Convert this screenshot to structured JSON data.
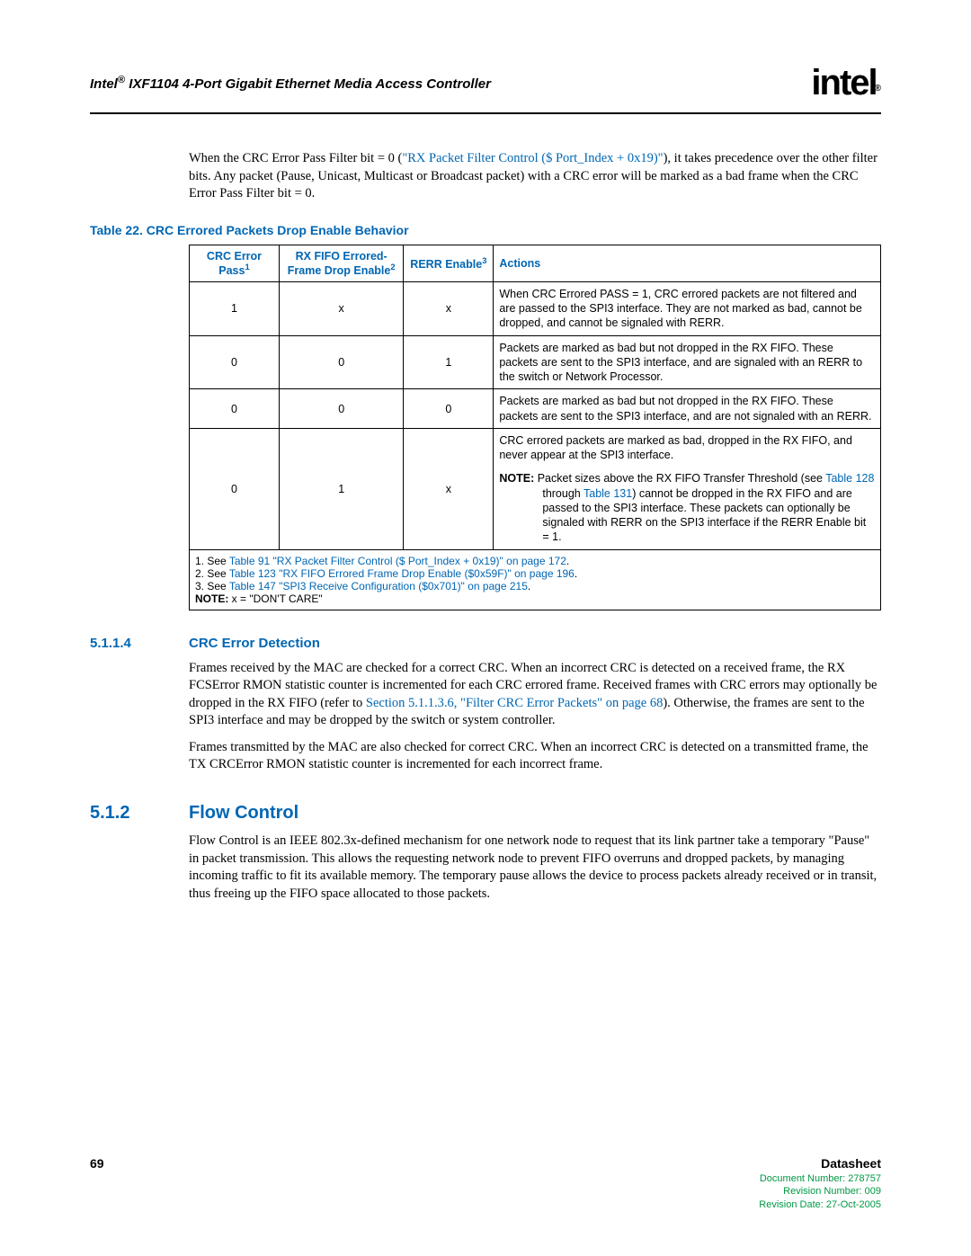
{
  "header": {
    "doc_title_prefix": "Intel",
    "doc_title_reg": "®",
    "doc_title_rest": " IXF1104 4-Port Gigabit Ethernet Media Access Controller",
    "logo_text": "intel"
  },
  "intro_para_pre": "When the CRC Error Pass Filter bit = 0 (",
  "intro_para_link": "\"RX Packet Filter Control ($ Port_Index + 0x19)\"",
  "intro_para_post": "), it takes precedence over the other filter bits. Any packet (Pause, Unicast, Multicast or Broadcast packet) with a CRC error will be marked as a bad frame when the CRC Error Pass Filter bit = 0.",
  "table_caption": "Table 22. CRC Errored Packets Drop Enable Behavior",
  "table_headers": {
    "h1": "CRC Error Pass",
    "h1_sup": "1",
    "h2": "RX FIFO Errored-Frame Drop Enable",
    "h2_sup": "2",
    "h3": "RERR Enable",
    "h3_sup": "3",
    "h4": "Actions"
  },
  "table_rows": [
    {
      "c1": "1",
      "c2": "x",
      "c3": "x",
      "actions": "When CRC Errored PASS = 1, CRC errored packets are not filtered and are passed to the SPI3 interface. They are not marked as bad, cannot be dropped, and cannot be signaled with RERR."
    },
    {
      "c1": "0",
      "c2": "0",
      "c3": "1",
      "actions": "Packets are marked as bad but not dropped in the RX FIFO. These packets are sent to the SPI3 interface, and are signaled with an RERR to the switch or Network Processor."
    },
    {
      "c1": "0",
      "c2": "0",
      "c3": "0",
      "actions": "Packets are marked as bad but not dropped in the RX FIFO. These packets are sent to the SPI3 interface, and are not signaled with an RERR."
    }
  ],
  "row4": {
    "c1": "0",
    "c2": "1",
    "c3": "x",
    "line1": "CRC errored packets are marked as bad, dropped in the RX FIFO, and never appear at the SPI3 interface.",
    "note_label": "NOTE:",
    "note_pre": "  Packet sizes above the RX FIFO Transfer Threshold (see ",
    "note_link1": "Table 128",
    "note_mid": " through ",
    "note_link2": "Table 131",
    "note_post": ") cannot be dropped in the RX FIFO and are passed to the SPI3 interface. These packets can optionally be signaled with RERR on the SPI3 interface if the RERR Enable bit = 1."
  },
  "footnotes": {
    "n1_pre": "1. See ",
    "n1_link": "Table 91 \"RX Packet Filter Control ($ Port_Index + 0x19)\" on page 172",
    "n1_post": ".",
    "n2_pre": "2. See ",
    "n2_link": "Table 123 \"RX FIFO Errored Frame Drop Enable ($0x59F)\" on page 196",
    "n2_post": ".",
    "n3_pre": "3. See ",
    "n3_link": "Table 147 \"SPI3 Receive Configuration ($0x701)\" on page 215",
    "n3_post": ".",
    "note_bold": "NOTE:",
    "note_text": "  x = \"DON'T CARE\""
  },
  "sec_5_1_1_4": {
    "num": "5.1.1.4",
    "title": "CRC Error Detection",
    "p1_pre": "Frames received by the MAC are checked for a correct CRC. When an incorrect CRC is detected on a received frame, the RX FCSError RMON statistic counter is incremented for each CRC errored frame. Received frames with CRC errors may optionally be dropped in the RX FIFO (refer to ",
    "p1_link": "Section 5.1.1.3.6, \"Filter CRC Error Packets\" on page 68",
    "p1_post": "). Otherwise, the frames are sent to the SPI3 interface and may be dropped by the switch or system controller.",
    "p2": "Frames transmitted by the MAC are also checked for correct CRC. When an incorrect CRC is detected on a transmitted frame, the TX CRCError RMON statistic counter is incremented for each incorrect frame."
  },
  "sec_5_1_2": {
    "num": "5.1.2",
    "title": "Flow Control",
    "p1": "Flow Control is an IEEE 802.3x-defined mechanism for one network node to request that its link partner take a temporary \"Pause\" in packet transmission. This allows the requesting network node to prevent FIFO overruns and dropped packets, by managing incoming traffic to fit its available memory. The temporary pause allows the device to process packets already received or in transit, thus freeing up the FIFO space allocated to those packets."
  },
  "footer": {
    "page": "69",
    "ds": "Datasheet",
    "docnum": "Document Number: 278757",
    "revnum": "Revision Number: 009",
    "revdate": "Revision Date: 27-Oct-2005"
  }
}
